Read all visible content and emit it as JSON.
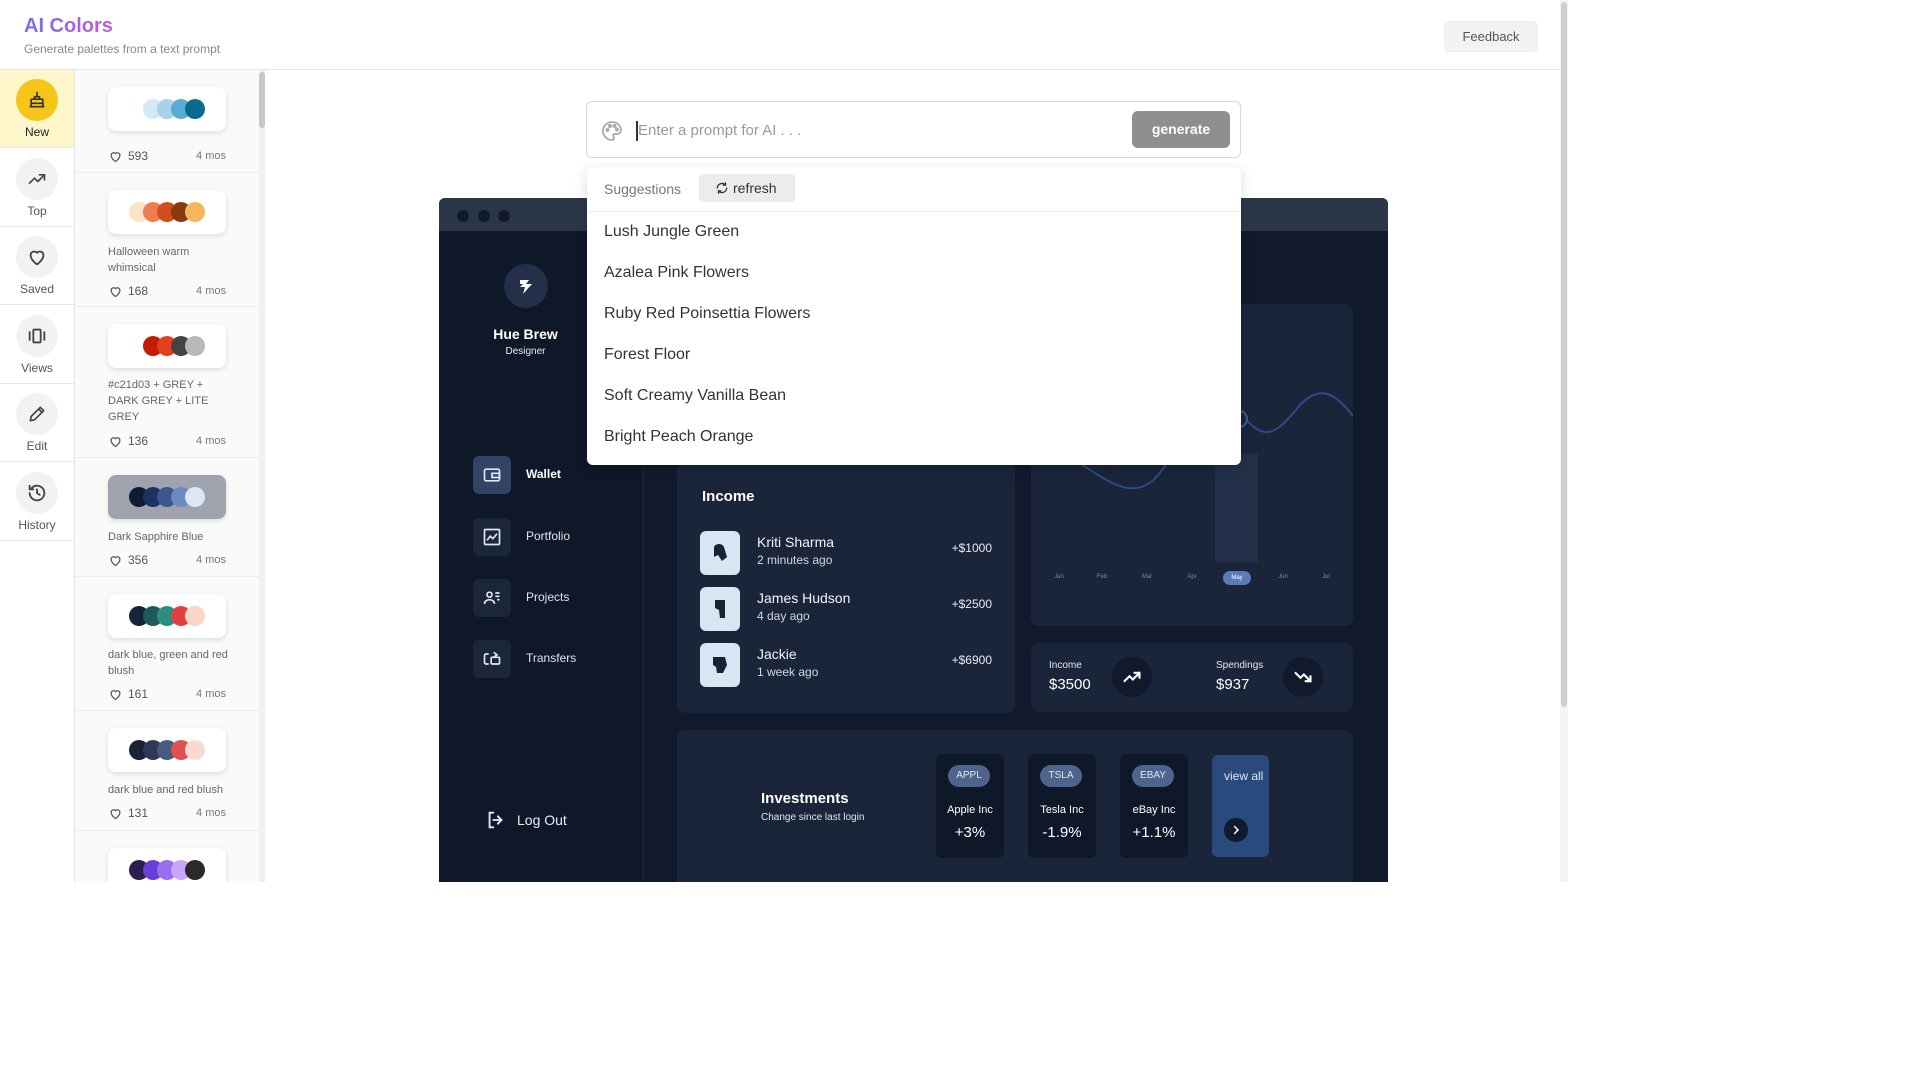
{
  "header": {
    "title": "AI Colors",
    "subtitle": "Generate palettes from a text prompt",
    "feedback_label": "Feedback"
  },
  "rail": {
    "items": [
      {
        "label": "New",
        "icon": "cake-icon",
        "active": true
      },
      {
        "label": "Top",
        "icon": "trending-up-icon"
      },
      {
        "label": "Saved",
        "icon": "heart-icon"
      },
      {
        "label": "Views",
        "icon": "carousel-icon"
      },
      {
        "label": "Edit",
        "icon": "pencil-icon"
      },
      {
        "label": "History",
        "icon": "history-icon"
      }
    ]
  },
  "palettes": [
    {
      "name": "",
      "likes": "593",
      "age": "4 mos",
      "colors": [
        "#ffffff",
        "#d4e8f5",
        "#a8d2ec",
        "#5aaad6",
        "#0b6a8c"
      ]
    },
    {
      "name": "Halloween warm whimsical",
      "likes": "168",
      "age": "4 mos",
      "colors": [
        "#fbe3c8",
        "#f07b4e",
        "#cf4f1f",
        "#8a3a12",
        "#f5b65c"
      ]
    },
    {
      "name": "#c21d03 + GREY + DARK GREY + LITE GREY",
      "likes": "136",
      "age": "4 mos",
      "colors": [
        "#ffffff",
        "#c21d03",
        "#e0411c",
        "#444444",
        "#b8b8b8"
      ]
    },
    {
      "name": "Dark Sapphire Blue",
      "likes": "356",
      "age": "4 mos",
      "colors": [
        "#0d1b33",
        "#1c3260",
        "#3b5790",
        "#6b8ac0",
        "#dbe6f7"
      ]
    },
    {
      "name": "dark blue, green and red blush",
      "likes": "161",
      "age": "4 mos",
      "colors": [
        "#14223a",
        "#1e5a5c",
        "#2a8f7e",
        "#e04040",
        "#fbd5c8"
      ]
    },
    {
      "name": "dark blue and red blush",
      "likes": "131",
      "age": "4 mos",
      "colors": [
        "#1b2235",
        "#2c3a58",
        "#485a7e",
        "#e05050",
        "#fcd9cf"
      ]
    },
    {
      "name": "",
      "likes": "",
      "age": "",
      "colors": [
        "#2a1f4d",
        "#6a3fd8",
        "#9a6ef0",
        "#c9a6f7",
        "#2a2a2a"
      ]
    }
  ],
  "prompt": {
    "placeholder": "Enter a prompt for AI . . .",
    "value": "",
    "generate_label": "generate"
  },
  "suggestions": {
    "title": "Suggestions",
    "refresh_label": "refresh",
    "items": [
      "Lush Jungle Green",
      "Azalea Pink Flowers",
      "Ruby Red Poinsettia Flowers",
      "Forest Floor",
      "Soft Creamy Vanilla Bean",
      "Bright Peach Orange"
    ]
  },
  "preview": {
    "user_name": "Hue Brew",
    "user_role": "Designer",
    "nav": [
      {
        "label": "Wallet",
        "icon": "wallet-icon",
        "active": true
      },
      {
        "label": "Portfolio",
        "icon": "chart-icon"
      },
      {
        "label": "Projects",
        "icon": "users-icon"
      },
      {
        "label": "Transfers",
        "icon": "transfer-icon"
      }
    ],
    "logout_label": "Log Out",
    "income_title": "Income",
    "income_rows": [
      {
        "name": "Kriti Sharma",
        "time": "2 minutes ago",
        "amount": "+$1000"
      },
      {
        "name": "James Hudson",
        "time": "4 day ago",
        "amount": "+$2500"
      },
      {
        "name": "Jackie",
        "time": "1 week ago",
        "amount": "+$6900"
      }
    ],
    "months": [
      "Jan",
      "Feb",
      "Mar",
      "Apr",
      "May",
      "Jun",
      "Jul"
    ],
    "active_month": "May",
    "stats": {
      "income_label": "Income",
      "income_value": "$3500",
      "spendings_label": "Spendings",
      "spendings_value": "$937"
    },
    "investments": {
      "title": "Investments",
      "subtitle": "Change since last login",
      "cards": [
        {
          "ticker": "APPL",
          "name": "Apple Inc",
          "change": "+3%"
        },
        {
          "ticker": "TSLA",
          "name": "Tesla Inc",
          "change": "-1.9%"
        },
        {
          "ticker": "EBAY",
          "name": "eBay Inc",
          "change": "+1.1%"
        }
      ],
      "view_all_label": "view all"
    }
  },
  "colors": {
    "brand_gradient_start": "#7b6cf0",
    "brand_gradient_end": "#c45ad8",
    "new_accent": "#f5c518",
    "preview_bg": "#111a2c",
    "preview_panel": "#1a253a"
  }
}
